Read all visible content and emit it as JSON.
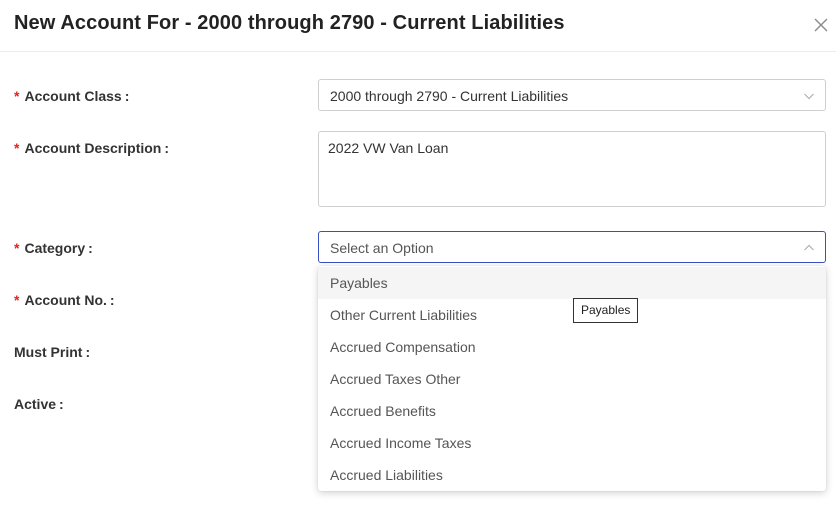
{
  "dialog": {
    "title": "New Account For - 2000 through 2790 - Current Liabilities",
    "close_icon": "close-icon"
  },
  "form": {
    "required_marker": "*",
    "colon": ":",
    "account_class": {
      "label": "Account Class",
      "value": "2000 through 2790 - Current Liabilities"
    },
    "account_description": {
      "label": "Account Description",
      "value": "2022 VW Van Loan"
    },
    "category": {
      "label": "Category",
      "placeholder": "Select an Option",
      "options": [
        "Payables",
        "Other Current Liabilities",
        "Accrued Compensation",
        "Accrued Taxes Other",
        "Accrued Benefits",
        "Accrued Income Taxes",
        "Accrued Liabilities"
      ],
      "hovered_option": "Payables"
    },
    "account_no": {
      "label": "Account No."
    },
    "must_print": {
      "label": "Must Print"
    },
    "active": {
      "label": "Active"
    }
  },
  "tooltip": {
    "text": "Payables"
  },
  "colors": {
    "required": "#e02424",
    "focus_border": "#3b4fc4",
    "hover_bg": "#f5f5f5"
  }
}
